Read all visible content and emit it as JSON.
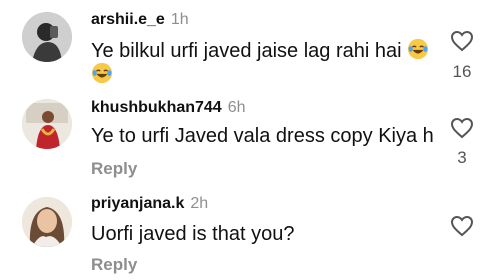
{
  "comments": [
    {
      "username": "arshii.e_e",
      "time": "1h",
      "text": "Ye bilkul urfi javed jaise lag rahi hai",
      "emoji": "tears-of-joy-emoji",
      "likes": "16",
      "reply_label": ""
    },
    {
      "username": "khushbukhan744",
      "time": "6h",
      "text": "Ye to urfi Javed vala dress copy Kiya h",
      "likes": "3",
      "reply_label": "Reply"
    },
    {
      "username": "priyanjana.k",
      "time": "2h",
      "text": "Uorfi javed is that you?",
      "likes": "",
      "reply_label": "Reply"
    }
  ],
  "icons": {
    "like": "heart-outline-icon"
  }
}
